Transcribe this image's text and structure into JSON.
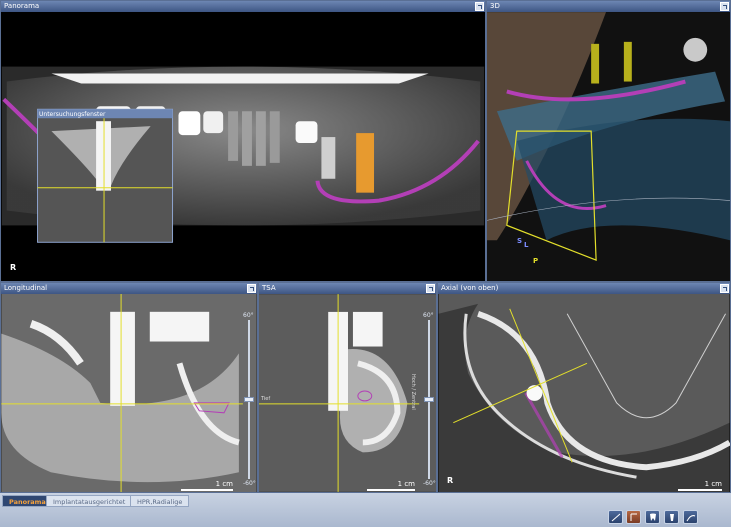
{
  "panels": {
    "panorama": {
      "title": "Panorama",
      "inset_title": "Untersuchungsfenster",
      "orientation": "R"
    },
    "view3d": {
      "title": "3D",
      "labels": {
        "s": "S",
        "l": "L",
        "p": "P"
      }
    },
    "longitudinal": {
      "title": "Longitudinal",
      "scale": "1 cm",
      "slider_top": "60°",
      "slider_bottom": "-60°"
    },
    "tsa": {
      "title": "TSA",
      "scale": "1 cm",
      "slider_top": "60°",
      "slider_bottom": "-60°",
      "side_label_left": "Tief",
      "side_label_right": "Hoch / Zentral"
    },
    "axial": {
      "title": "Axial (von oben)",
      "orientation": "R",
      "scale": "1 cm"
    }
  },
  "tabs": [
    {
      "label": "Panorama",
      "active": true
    },
    {
      "label": "Implantatausgerichtet",
      "active": false
    },
    {
      "label": "HPR,Radialige",
      "active": false
    }
  ],
  "toolbar": [
    "measure-icon",
    "contour-icon",
    "tooth-icon",
    "implant-icon",
    "nerve-icon"
  ],
  "colors": {
    "panel_border": "#5a6f94",
    "crosshair": "#e3df2b",
    "nerve": "#b33fb6",
    "implant": "#e79a2f"
  }
}
